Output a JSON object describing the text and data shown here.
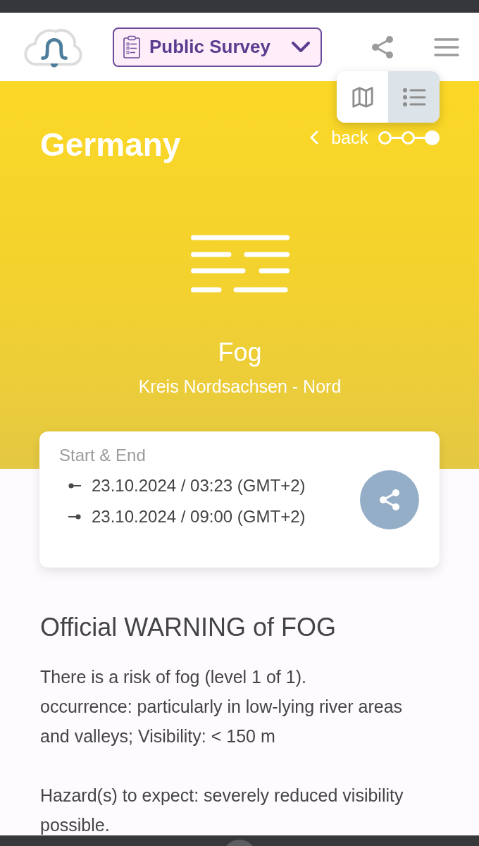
{
  "header": {
    "survey_button": {
      "label": "Public Survey"
    }
  },
  "view_toggle": [
    {
      "kind": "map",
      "selected": false
    },
    {
      "kind": "list",
      "selected": true
    }
  ],
  "hero": {
    "title": "Germany",
    "back": {
      "label": "back"
    },
    "steps": [
      {
        "selected": false
      },
      {
        "selected": false
      },
      {
        "selected": true
      }
    ],
    "event": "Fog",
    "area": "Kreis Nordsachsen - Nord"
  },
  "time_card": {
    "heading": "Start & End",
    "rows": [
      {
        "kind": "start",
        "text": "23.10.2024 / 03:23 (GMT+2)"
      },
      {
        "kind": "end",
        "text": "23.10.2024 / 09:00 (GMT+2)"
      }
    ]
  },
  "details": {
    "title": "Official WARNING of FOG",
    "paragraphs": [
      "There is a risk of fog (level 1 of 1).\noccurrence: particularly in low-lying river areas and valleys; Visibility: < 150 m",
      "Hazard(s) to expect: severely reduced visibility possible."
    ]
  }
}
